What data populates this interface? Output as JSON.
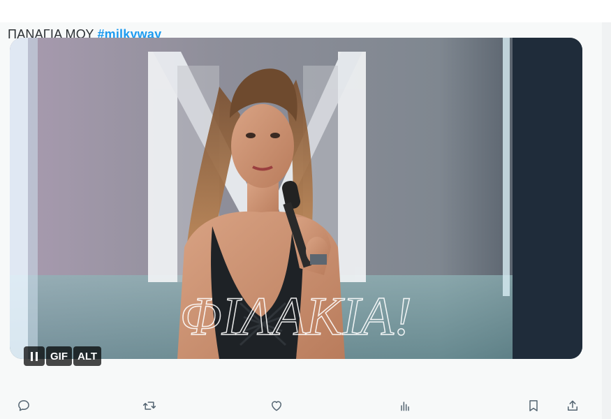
{
  "tweet": {
    "text": "ΠΑΝΑΓΙΑ ΜΟΥ ",
    "hashtag": "#milkyway"
  },
  "media": {
    "overlay_caption": "ΦΙΛΑΚΙΑ!",
    "badges": {
      "gif_label": "GIF",
      "alt_label": "ALT"
    }
  },
  "actions": {
    "icons": [
      "reply-icon",
      "retweet-icon",
      "like-icon",
      "views-icon",
      "bookmark-icon",
      "share-icon"
    ]
  },
  "colors": {
    "hashtag": "#1d9bf0",
    "icon": "#536471",
    "badge_bg": "#000000"
  }
}
